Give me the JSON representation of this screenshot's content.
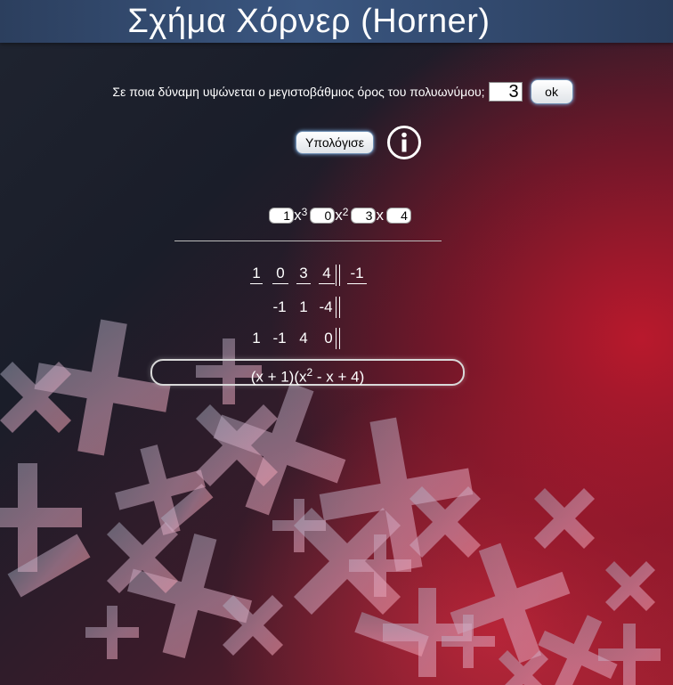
{
  "header": {
    "title": "Σχήμα Χόρνερ (Horner)"
  },
  "degree_prompt": {
    "question": "Σε ποια δύναμη υψώνεται ο μεγιστοβάθμιος όρος του πολυωνύμου;",
    "value": "3",
    "ok_label": "ok"
  },
  "compute": {
    "label": "Υπολόγισε",
    "info_icon": "info-icon"
  },
  "polynomial": {
    "terms": [
      {
        "coef": "1",
        "var": "x",
        "exp": "3"
      },
      {
        "coef": "0",
        "var": "x",
        "exp": "2"
      },
      {
        "coef": "3",
        "var": "x",
        "exp": ""
      },
      {
        "coef": "4",
        "var": "",
        "exp": ""
      }
    ]
  },
  "horner": {
    "row1": [
      "1",
      "0",
      "3",
      "4"
    ],
    "root": "-1",
    "row2": [
      "-1",
      "1",
      "-4"
    ],
    "row3": [
      "1",
      "-1",
      "4",
      "0"
    ]
  },
  "result": {
    "prefix": "(x + 1)(x",
    "exp": "2",
    "suffix": " - x + 4)"
  }
}
